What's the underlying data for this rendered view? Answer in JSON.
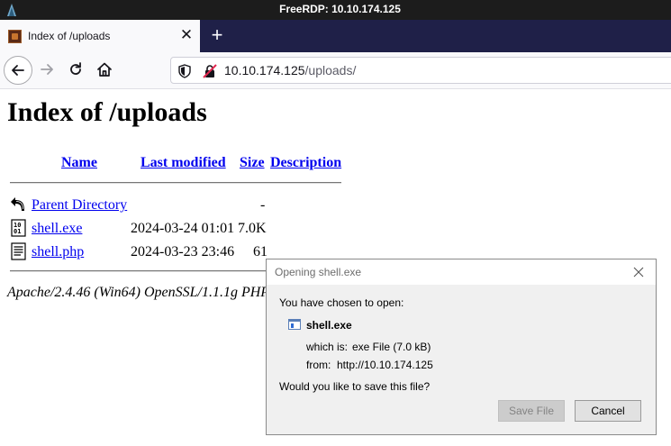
{
  "rdp": {
    "title": "FreeRDP: 10.10.174.125"
  },
  "browser": {
    "tab_title": "Index of /uploads",
    "tab_close": "✕",
    "new_tab": "+",
    "url_host": "10.10.174.125",
    "url_path": "/uploads/"
  },
  "listing": {
    "heading": "Index of /uploads",
    "columns": [
      "Name",
      "Last modified",
      "Size",
      "Description"
    ],
    "rows": [
      {
        "icon": "back-icon",
        "name": "Parent Directory",
        "modified": "",
        "size": "-",
        "description": ""
      },
      {
        "icon": "binary-file-icon",
        "name": "shell.exe",
        "modified": "2024-03-24 01:01",
        "size": "7.0K",
        "description": ""
      },
      {
        "icon": "text-file-icon",
        "name": "shell.php",
        "modified": "2024-03-23 23:46",
        "size": "61",
        "description": ""
      }
    ],
    "footer": "Apache/2.4.46 (Win64) OpenSSL/1.1.1g PHP"
  },
  "dialog": {
    "title": "Opening shell.exe",
    "intro": "You have chosen to open:",
    "filename": "shell.exe",
    "which_is_label": "which is:",
    "which_is_value": "exe File (7.0 kB)",
    "from_label": "from:",
    "from_value": "http://10.10.174.125",
    "question": "Would you like to save this file?",
    "save_label": "Save File",
    "cancel_label": "Cancel"
  },
  "colors": {
    "link": "#0000ee",
    "tab_strip": "#1f2048",
    "rdp_bar": "#1c1c1c",
    "dialog_bg": "#f0f0f0"
  }
}
